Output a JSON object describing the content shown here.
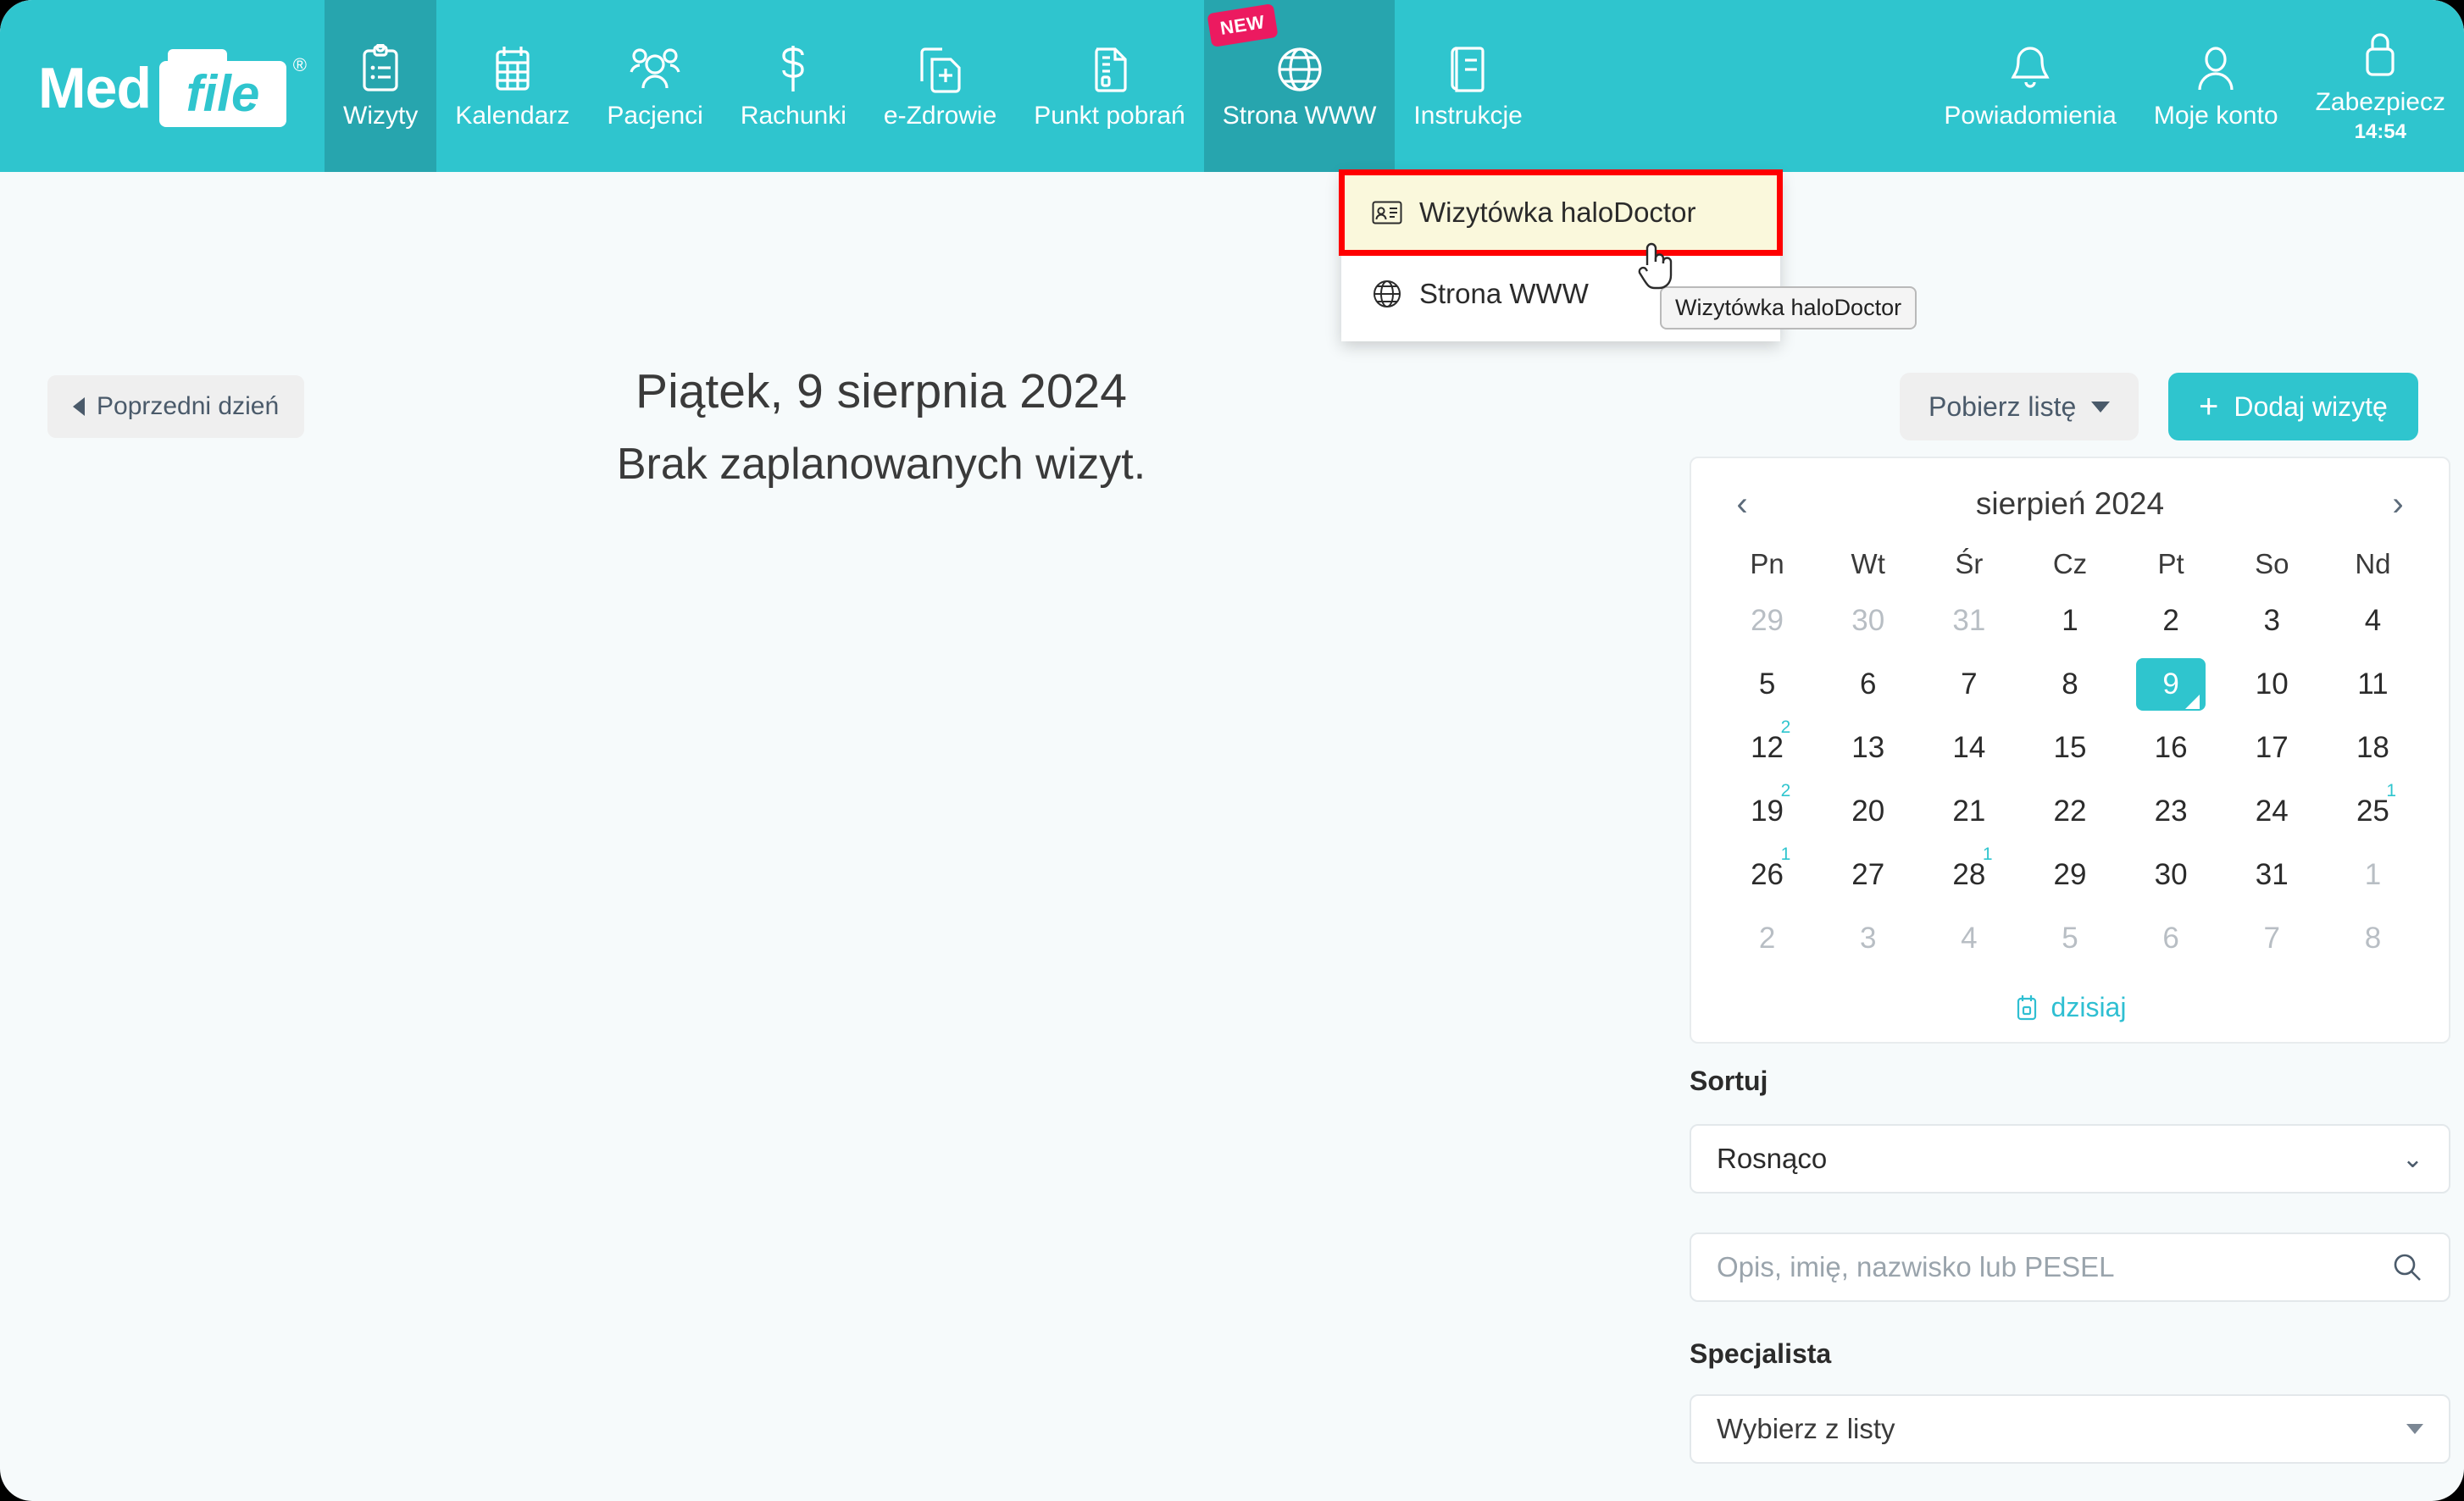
{
  "brand": {
    "name_part1": "Med",
    "name_part2": "file",
    "registered": "®"
  },
  "nav": {
    "items": [
      {
        "label": "Wizyty",
        "icon": "clipboard-list-icon",
        "active": true,
        "badge": null
      },
      {
        "label": "Kalendarz",
        "icon": "calendar-grid-icon",
        "active": false,
        "badge": null
      },
      {
        "label": "Pacjenci",
        "icon": "people-icon",
        "active": false,
        "badge": null
      },
      {
        "label": "Rachunki",
        "icon": "dollar-icon",
        "active": false,
        "badge": null
      },
      {
        "label": "e-Zdrowie",
        "icon": "documents-plus-icon",
        "active": false,
        "badge": null
      },
      {
        "label": "Punkt pobrań",
        "icon": "document-lines-icon",
        "active": false,
        "badge": null
      },
      {
        "label": "Strona WWW",
        "icon": "globe-icon",
        "active": true,
        "badge": "NEW"
      },
      {
        "label": "Instrukcje",
        "icon": "book-icon",
        "active": false,
        "badge": null
      }
    ],
    "right_items": [
      {
        "label": "Powiadomienia",
        "icon": "bell-icon",
        "sub": null
      },
      {
        "label": "Moje konto",
        "icon": "person-icon",
        "sub": null
      },
      {
        "label": "Zabezpiecz",
        "icon": "lock-icon",
        "sub": "14:54"
      }
    ]
  },
  "dropdown": {
    "items": [
      {
        "label": "Wizytówka haloDoctor",
        "icon": "id-card-icon",
        "highlighted": true
      },
      {
        "label": "Strona WWW",
        "icon": "globe-icon",
        "highlighted": false
      }
    ]
  },
  "tooltip": {
    "text": "Wizytówka haloDoctor"
  },
  "toolbar": {
    "prev_day": "Poprzedni dzień",
    "download_list": "Pobierz listę",
    "add_visit": "Dodaj wizytę",
    "add_visit_plus": "+"
  },
  "main": {
    "date_heading": "Piątek, 9 sierpnia 2024",
    "empty_message": "Brak zaplanowanych wizyt."
  },
  "calendar": {
    "title": "sierpień 2024",
    "prev_icon": "chevron-left-icon",
    "next_icon": "chevron-right-icon",
    "weekdays": [
      "Pn",
      "Wt",
      "Śr",
      "Cz",
      "Pt",
      "So",
      "Nd"
    ],
    "today_label": "dzisiaj",
    "today_icon": "calendar-today-icon",
    "selected_day": 9,
    "accent": "#2FC5CE",
    "weeks": [
      [
        {
          "d": "29",
          "muted": true
        },
        {
          "d": "30",
          "muted": true
        },
        {
          "d": "31",
          "muted": true
        },
        {
          "d": "1",
          "muted": false
        },
        {
          "d": "2",
          "muted": false
        },
        {
          "d": "3",
          "muted": false
        },
        {
          "d": "4",
          "muted": false
        }
      ],
      [
        {
          "d": "5",
          "muted": false
        },
        {
          "d": "6",
          "muted": false
        },
        {
          "d": "7",
          "muted": false
        },
        {
          "d": "8",
          "muted": false
        },
        {
          "d": "9",
          "muted": false,
          "selected": true
        },
        {
          "d": "10",
          "muted": false
        },
        {
          "d": "11",
          "muted": false
        }
      ],
      [
        {
          "d": "12",
          "muted": false,
          "count": "2"
        },
        {
          "d": "13",
          "muted": false
        },
        {
          "d": "14",
          "muted": false
        },
        {
          "d": "15",
          "muted": false
        },
        {
          "d": "16",
          "muted": false
        },
        {
          "d": "17",
          "muted": false
        },
        {
          "d": "18",
          "muted": false
        }
      ],
      [
        {
          "d": "19",
          "muted": false,
          "count": "2"
        },
        {
          "d": "20",
          "muted": false
        },
        {
          "d": "21",
          "muted": false
        },
        {
          "d": "22",
          "muted": false
        },
        {
          "d": "23",
          "muted": false
        },
        {
          "d": "24",
          "muted": false
        },
        {
          "d": "25",
          "muted": false,
          "count": "1"
        }
      ],
      [
        {
          "d": "26",
          "muted": false,
          "count": "1"
        },
        {
          "d": "27",
          "muted": false
        },
        {
          "d": "28",
          "muted": false,
          "count": "1"
        },
        {
          "d": "29",
          "muted": false
        },
        {
          "d": "30",
          "muted": false
        },
        {
          "d": "31",
          "muted": false
        },
        {
          "d": "1",
          "muted": true
        }
      ],
      [
        {
          "d": "2",
          "muted": true
        },
        {
          "d": "3",
          "muted": true
        },
        {
          "d": "4",
          "muted": true
        },
        {
          "d": "5",
          "muted": true
        },
        {
          "d": "6",
          "muted": true
        },
        {
          "d": "7",
          "muted": true
        },
        {
          "d": "8",
          "muted": true
        }
      ]
    ]
  },
  "filters": {
    "sort_label": "Sortuj",
    "sort_value": "Rosnąco",
    "search_placeholder": "Opis, imię, nazwisko lub PESEL",
    "search_value": "",
    "search_icon": "search-icon",
    "specialist_label": "Specjalista",
    "specialist_value": "Wybierz z listy"
  }
}
